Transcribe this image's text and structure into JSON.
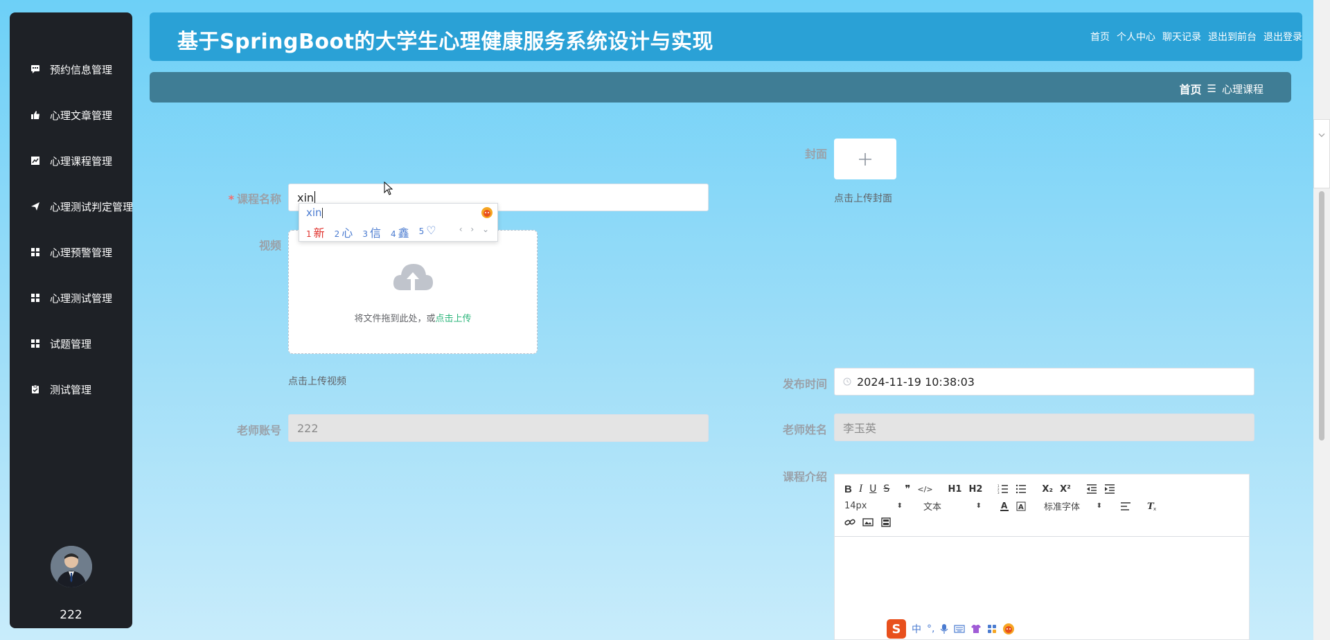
{
  "app": {
    "title": "基于SpringBoot的大学生心理健康服务系统设计与实现",
    "nav": [
      "首页",
      "个人中心",
      "聊天记录",
      "退出到前台",
      "退出登录"
    ]
  },
  "breadcrumb": {
    "home": "首页",
    "separator": "☰",
    "current": "心理课程"
  },
  "sidebar": {
    "items": [
      {
        "label": "预约信息管理",
        "icon": "chat-icon"
      },
      {
        "label": "心理文章管理",
        "icon": "thumb-icon"
      },
      {
        "label": "心理课程管理",
        "icon": "chart-icon"
      },
      {
        "label": "心理测试判定管理",
        "icon": "send-icon"
      },
      {
        "label": "心理预警管理",
        "icon": "grid-icon"
      },
      {
        "label": "心理测试管理",
        "icon": "grid-icon"
      },
      {
        "label": "试题管理",
        "icon": "grid-icon"
      },
      {
        "label": "测试管理",
        "icon": "clipboard-icon"
      }
    ],
    "user": "222"
  },
  "form": {
    "course_name_label": "课程名称",
    "course_name_value": "xin",
    "cover_label": "封面",
    "cover_hint": "点击上传封面",
    "video_label": "视频",
    "video_upload_text": "将文件拖到此处，或",
    "video_upload_link": "点击上传",
    "video_hint": "点击上传视频",
    "publish_time_label": "发布时间",
    "publish_time_value": "2024-11-19 10:38:03",
    "teacher_account_label": "老师账号",
    "teacher_account_value": "222",
    "teacher_name_label": "老师姓名",
    "teacher_name_value": "李玉英",
    "intro_label": "课程介绍"
  },
  "ime": {
    "code": "xin",
    "candidates": [
      {
        "n": "1",
        "text": "新"
      },
      {
        "n": "2",
        "text": "心"
      },
      {
        "n": "3",
        "text": "信"
      },
      {
        "n": "4",
        "text": "鑫"
      },
      {
        "n": "5",
        "text": "♡"
      }
    ]
  },
  "editor": {
    "font_size": "14px",
    "block_type": "文本",
    "font_family": "标准字体",
    "buttons_row1": [
      "B",
      "I",
      "U",
      "S",
      "❞",
      "</>",
      "H1",
      "H2",
      "ol",
      "ul",
      "X₂",
      "X²",
      "outdent",
      "indent"
    ]
  },
  "ime_bar": [
    "中",
    "°,",
    "mic",
    "kbd",
    "shirt",
    "apps",
    "face"
  ]
}
